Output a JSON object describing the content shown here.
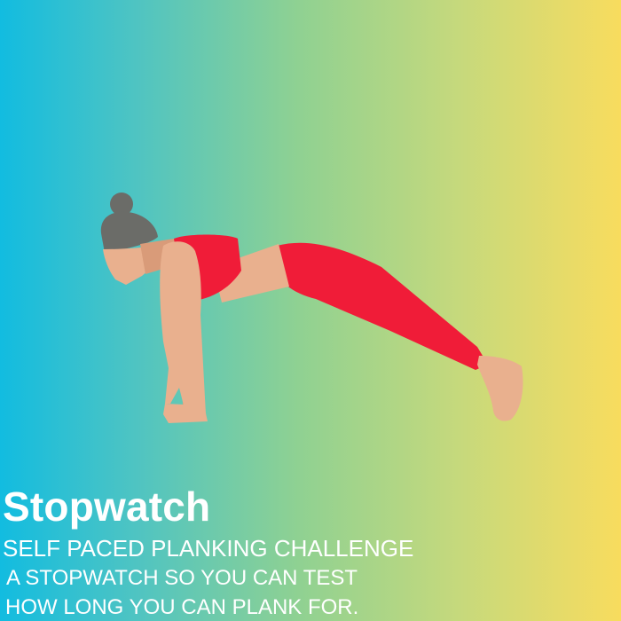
{
  "card": {
    "title": "Stopwatch",
    "subtitle": "SELF PACED PLANKING CHALLENGE",
    "description_lines": [
      " A STOPWATCH SO YOU CAN TEST",
      " HOW LONG YOU CAN PLANK FOR."
    ],
    "illustration": "plank-woman-illustration"
  },
  "colors": {
    "gradient_start": "#12BCE0",
    "gradient_end": "#F8DC5E",
    "outfit": "#F01C38",
    "skin": "#E9B08E",
    "hair": "#6B6C68",
    "text": "#FFFFFF"
  }
}
